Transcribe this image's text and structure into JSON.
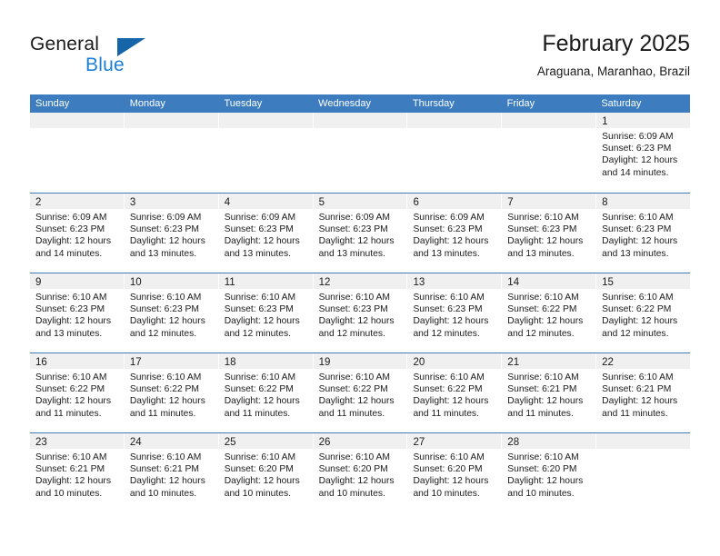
{
  "brand": {
    "name_part1": "General",
    "name_part2": "Blue",
    "triangle_color": "#1565a8",
    "blue_color": "#1c7fd4"
  },
  "header": {
    "title": "February 2025",
    "subtitle": "Araguana, Maranhao, Brazil"
  },
  "theme": {
    "header_bg": "#3c7cbf",
    "header_text": "#ffffff",
    "day_band_bg": "#f0f0f0",
    "row_divider": "#3c7cbf"
  },
  "weekdays": [
    "Sunday",
    "Monday",
    "Tuesday",
    "Wednesday",
    "Thursday",
    "Friday",
    "Saturday"
  ],
  "labels": {
    "sunrise_prefix": "Sunrise:",
    "sunset_prefix": "Sunset:",
    "daylight_prefix": "Daylight:"
  },
  "weeks": [
    [
      {
        "empty": true
      },
      {
        "empty": true
      },
      {
        "empty": true
      },
      {
        "empty": true
      },
      {
        "empty": true
      },
      {
        "empty": true
      },
      {
        "day": "1",
        "sunrise": "Sunrise: 6:09 AM",
        "sunset": "Sunset: 6:23 PM",
        "daylight": "Daylight: 12 hours and 14 minutes."
      }
    ],
    [
      {
        "day": "2",
        "sunrise": "Sunrise: 6:09 AM",
        "sunset": "Sunset: 6:23 PM",
        "daylight": "Daylight: 12 hours and 14 minutes."
      },
      {
        "day": "3",
        "sunrise": "Sunrise: 6:09 AM",
        "sunset": "Sunset: 6:23 PM",
        "daylight": "Daylight: 12 hours and 13 minutes."
      },
      {
        "day": "4",
        "sunrise": "Sunrise: 6:09 AM",
        "sunset": "Sunset: 6:23 PM",
        "daylight": "Daylight: 12 hours and 13 minutes."
      },
      {
        "day": "5",
        "sunrise": "Sunrise: 6:09 AM",
        "sunset": "Sunset: 6:23 PM",
        "daylight": "Daylight: 12 hours and 13 minutes."
      },
      {
        "day": "6",
        "sunrise": "Sunrise: 6:09 AM",
        "sunset": "Sunset: 6:23 PM",
        "daylight": "Daylight: 12 hours and 13 minutes."
      },
      {
        "day": "7",
        "sunrise": "Sunrise: 6:10 AM",
        "sunset": "Sunset: 6:23 PM",
        "daylight": "Daylight: 12 hours and 13 minutes."
      },
      {
        "day": "8",
        "sunrise": "Sunrise: 6:10 AM",
        "sunset": "Sunset: 6:23 PM",
        "daylight": "Daylight: 12 hours and 13 minutes."
      }
    ],
    [
      {
        "day": "9",
        "sunrise": "Sunrise: 6:10 AM",
        "sunset": "Sunset: 6:23 PM",
        "daylight": "Daylight: 12 hours and 13 minutes."
      },
      {
        "day": "10",
        "sunrise": "Sunrise: 6:10 AM",
        "sunset": "Sunset: 6:23 PM",
        "daylight": "Daylight: 12 hours and 12 minutes."
      },
      {
        "day": "11",
        "sunrise": "Sunrise: 6:10 AM",
        "sunset": "Sunset: 6:23 PM",
        "daylight": "Daylight: 12 hours and 12 minutes."
      },
      {
        "day": "12",
        "sunrise": "Sunrise: 6:10 AM",
        "sunset": "Sunset: 6:23 PM",
        "daylight": "Daylight: 12 hours and 12 minutes."
      },
      {
        "day": "13",
        "sunrise": "Sunrise: 6:10 AM",
        "sunset": "Sunset: 6:23 PM",
        "daylight": "Daylight: 12 hours and 12 minutes."
      },
      {
        "day": "14",
        "sunrise": "Sunrise: 6:10 AM",
        "sunset": "Sunset: 6:22 PM",
        "daylight": "Daylight: 12 hours and 12 minutes."
      },
      {
        "day": "15",
        "sunrise": "Sunrise: 6:10 AM",
        "sunset": "Sunset: 6:22 PM",
        "daylight": "Daylight: 12 hours and 12 minutes."
      }
    ],
    [
      {
        "day": "16",
        "sunrise": "Sunrise: 6:10 AM",
        "sunset": "Sunset: 6:22 PM",
        "daylight": "Daylight: 12 hours and 11 minutes."
      },
      {
        "day": "17",
        "sunrise": "Sunrise: 6:10 AM",
        "sunset": "Sunset: 6:22 PM",
        "daylight": "Daylight: 12 hours and 11 minutes."
      },
      {
        "day": "18",
        "sunrise": "Sunrise: 6:10 AM",
        "sunset": "Sunset: 6:22 PM",
        "daylight": "Daylight: 12 hours and 11 minutes."
      },
      {
        "day": "19",
        "sunrise": "Sunrise: 6:10 AM",
        "sunset": "Sunset: 6:22 PM",
        "daylight": "Daylight: 12 hours and 11 minutes."
      },
      {
        "day": "20",
        "sunrise": "Sunrise: 6:10 AM",
        "sunset": "Sunset: 6:22 PM",
        "daylight": "Daylight: 12 hours and 11 minutes."
      },
      {
        "day": "21",
        "sunrise": "Sunrise: 6:10 AM",
        "sunset": "Sunset: 6:21 PM",
        "daylight": "Daylight: 12 hours and 11 minutes."
      },
      {
        "day": "22",
        "sunrise": "Sunrise: 6:10 AM",
        "sunset": "Sunset: 6:21 PM",
        "daylight": "Daylight: 12 hours and 11 minutes."
      }
    ],
    [
      {
        "day": "23",
        "sunrise": "Sunrise: 6:10 AM",
        "sunset": "Sunset: 6:21 PM",
        "daylight": "Daylight: 12 hours and 10 minutes."
      },
      {
        "day": "24",
        "sunrise": "Sunrise: 6:10 AM",
        "sunset": "Sunset: 6:21 PM",
        "daylight": "Daylight: 12 hours and 10 minutes."
      },
      {
        "day": "25",
        "sunrise": "Sunrise: 6:10 AM",
        "sunset": "Sunset: 6:20 PM",
        "daylight": "Daylight: 12 hours and 10 minutes."
      },
      {
        "day": "26",
        "sunrise": "Sunrise: 6:10 AM",
        "sunset": "Sunset: 6:20 PM",
        "daylight": "Daylight: 12 hours and 10 minutes."
      },
      {
        "day": "27",
        "sunrise": "Sunrise: 6:10 AM",
        "sunset": "Sunset: 6:20 PM",
        "daylight": "Daylight: 12 hours and 10 minutes."
      },
      {
        "day": "28",
        "sunrise": "Sunrise: 6:10 AM",
        "sunset": "Sunset: 6:20 PM",
        "daylight": "Daylight: 12 hours and 10 minutes."
      },
      {
        "empty": true
      }
    ]
  ]
}
